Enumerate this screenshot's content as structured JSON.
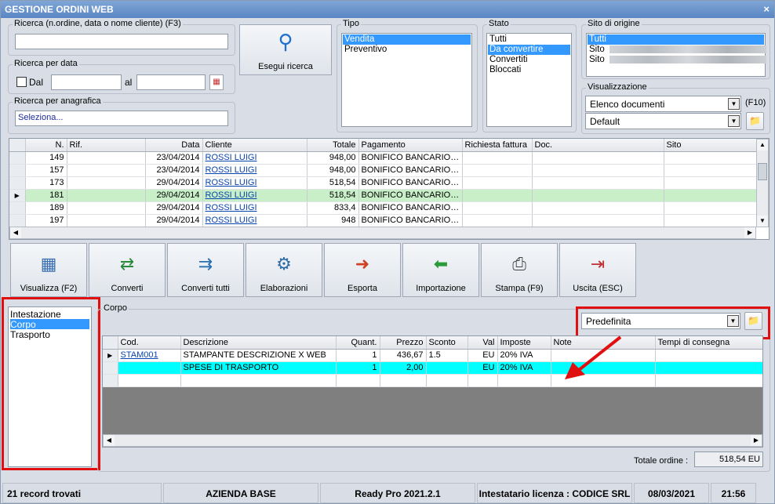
{
  "window": {
    "title": "GESTIONE ORDINI WEB",
    "close": "×"
  },
  "search": {
    "text_group": "Ricerca (n.ordine, data o nome cliente) (F3)",
    "text_value": "",
    "date_group": "Ricerca per data",
    "dal_label": "Dal",
    "al_label": "al",
    "anagrafica_group": "Ricerca per anagrafica",
    "anagrafica_value": "Seleziona...",
    "button": "Esegui ricerca"
  },
  "tipo": {
    "label": "Tipo",
    "items": [
      "Vendita",
      "Preventivo"
    ]
  },
  "stato": {
    "label": "Stato",
    "items": [
      "Tutti",
      "Da convertire",
      "Convertiti",
      "Bloccati"
    ]
  },
  "sito": {
    "label": "Sito di origine",
    "items": [
      "Tutti",
      "Sito",
      "Sito"
    ]
  },
  "visualizzazione": {
    "label": "Visualizzazione",
    "combo1": "Elenco documenti",
    "shortcut": "(F10)",
    "combo2": "Default"
  },
  "orders": {
    "columns": [
      "N.",
      "Rif.",
      "Data",
      "Cliente",
      "Totale",
      "Pagamento",
      "Richiesta fattura",
      "Doc.",
      "Sito"
    ],
    "rows": [
      {
        "n": "149",
        "rif": "",
        "data": "23/04/2014",
        "cliente": "ROSSI LUIGI",
        "totale": "948,00",
        "pag": "BONIFICO BANCARIO ...",
        "rf": "",
        "doc": "",
        "sito": ""
      },
      {
        "n": "157",
        "rif": "",
        "data": "23/04/2014",
        "cliente": "ROSSI LUIGI",
        "totale": "948,00",
        "pag": "BONIFICO BANCARIO ...",
        "rf": "",
        "doc": "",
        "sito": ""
      },
      {
        "n": "173",
        "rif": "",
        "data": "29/04/2014",
        "cliente": "ROSSI LUIGI",
        "totale": "518,54",
        "pag": "BONIFICO BANCARIO ...",
        "rf": "",
        "doc": "",
        "sito": ""
      },
      {
        "n": "181",
        "rif": "",
        "data": "29/04/2014",
        "cliente": "ROSSI LUIGI",
        "totale": "518,54",
        "pag": "BONIFICO BANCARIO ...",
        "rf": "",
        "doc": "",
        "sito": ""
      },
      {
        "n": "189",
        "rif": "",
        "data": "29/04/2014",
        "cliente": "ROSSI LUIGI",
        "totale": "833,4",
        "pag": "BONIFICO BANCARIO ...",
        "rf": "",
        "doc": "",
        "sito": ""
      },
      {
        "n": "197",
        "rif": "",
        "data": "29/04/2014",
        "cliente": "ROSSI LUIGI",
        "totale": "948",
        "pag": "BONIFICO BANCARIO ...",
        "rf": "",
        "doc": "",
        "sito": ""
      }
    ],
    "selected_index": 3
  },
  "toolbar": [
    {
      "label": "Visualizza (F2)",
      "icon": "grid-icon"
    },
    {
      "label": "Converti",
      "icon": "convert-icon"
    },
    {
      "label": "Converti tutti",
      "icon": "convert-all-icon"
    },
    {
      "label": "Elaborazioni",
      "icon": "gear-document-icon"
    },
    {
      "label": "Esporta",
      "icon": "export-icon"
    },
    {
      "label": "Importazione",
      "icon": "import-icon"
    },
    {
      "label": "Stampa (F9)",
      "icon": "printer-icon"
    },
    {
      "label": "Uscita (ESC)",
      "icon": "exit-icon"
    }
  ],
  "sections": {
    "items": [
      "Intestazione",
      "Corpo",
      "Trasporto"
    ],
    "selected": 1
  },
  "corpo": {
    "label": "Corpo",
    "layout_combo": "Predefinita",
    "columns": [
      "Cod.",
      "Descrizione",
      "Quant.",
      "Prezzo",
      "Sconto",
      "Val",
      "Imposte",
      "Note",
      "Tempi di consegna"
    ],
    "rows": [
      {
        "cod": "STAM001",
        "desc": "STAMPANTE DESCRIZIONE X WEB",
        "q": "1",
        "prezzo": "436,67",
        "sconto": "1.5",
        "val": "EU",
        "imp": "20% IVA",
        "note": "",
        "tempi": ""
      },
      {
        "cod": "",
        "desc": "SPESE DI TRASPORTO",
        "q": "1",
        "prezzo": "2,00",
        "sconto": "",
        "val": "EU",
        "imp": "20% IVA",
        "note": "",
        "tempi": ""
      }
    ],
    "total_label": "Totale ordine :",
    "total_value": "518,54 EU"
  },
  "statusbar": {
    "records": "21 record trovati",
    "azienda": "AZIENDA BASE",
    "version": "Ready Pro 2021.2.1",
    "licenza": "Intestatario licenza : CODICE SRL",
    "date": "08/03/2021",
    "time": "21:56"
  },
  "colors": {
    "selected_row": "#c8efc8",
    "cyan_row": "#00ffff",
    "highlight": "#e01010",
    "title": "#5a86c4"
  }
}
